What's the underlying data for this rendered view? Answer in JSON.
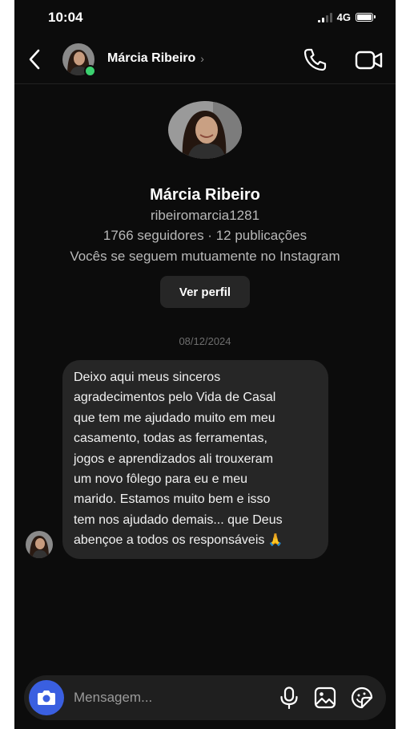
{
  "status": {
    "time": "10:04",
    "network": "4G"
  },
  "header": {
    "name": "Márcia Ribeiro",
    "chevron": "›"
  },
  "profile": {
    "name": "Márcia Ribeiro",
    "username": "ribeiromarcia1281",
    "stats": "1766 seguidores · 12 publicações",
    "mutual": "Vocês se seguem mutuamente no Instagram",
    "view_profile_label": "Ver perfil"
  },
  "conversation": {
    "date": "08/12/2024",
    "message_lines": [
      "Deixo aqui meus sinceros",
      "agradecimentos pelo Vida de Casal",
      "que tem me ajudado muito em meu",
      "casamento, todas as ferramentas,",
      "jogos e aprendizados ali trouxeram",
      "um novo fôlego para eu e meu",
      "marido. Estamos muito bem e isso",
      "tem nos ajudado demais... que Deus",
      "abençoe a todos os responsáveis"
    ],
    "message_emoji": "🙏"
  },
  "composer": {
    "placeholder": "Mensagem..."
  },
  "icons": {
    "back": "back-chevron-icon",
    "call": "phone-icon",
    "video": "video-camera-icon",
    "camera": "camera-icon",
    "mic": "microphone-icon",
    "gallery": "image-icon",
    "sticker": "sticker-icon"
  },
  "colors": {
    "background": "#0c0c0c",
    "bubble": "#262626",
    "online": "#3bd16f",
    "camera_button": "#3a5fe0"
  }
}
